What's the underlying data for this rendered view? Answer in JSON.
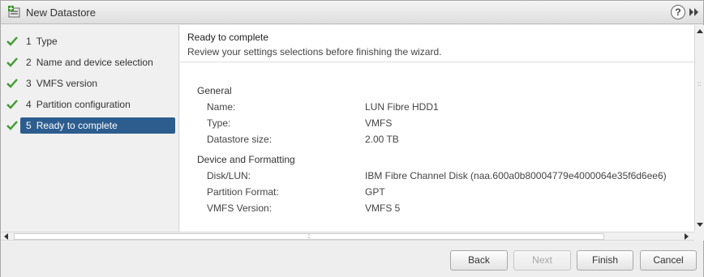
{
  "window": {
    "title": "New Datastore"
  },
  "titlebar_icons": {
    "app": "datastore-add-icon",
    "help": "help-icon",
    "help_glyph": "?",
    "expand": "expand-icon"
  },
  "steps": [
    {
      "number": "1",
      "label": "Type",
      "completed": true,
      "active": false
    },
    {
      "number": "2",
      "label": "Name and device selection",
      "completed": true,
      "active": false
    },
    {
      "number": "3",
      "label": "VMFS version",
      "completed": true,
      "active": false
    },
    {
      "number": "4",
      "label": "Partition configuration",
      "completed": true,
      "active": false
    },
    {
      "number": "5",
      "label": "Ready to complete",
      "completed": true,
      "active": true
    }
  ],
  "content": {
    "header_title": "Ready to complete",
    "header_subtitle": "Review your settings selections before finishing the wizard.",
    "sections": [
      {
        "title": "General",
        "rows": [
          {
            "label": "Name:",
            "value": "LUN Fibre HDD1"
          },
          {
            "label": "Type:",
            "value": "VMFS"
          },
          {
            "label": "Datastore size:",
            "value": "2.00 TB"
          }
        ]
      },
      {
        "title": "Device and Formatting",
        "rows": [
          {
            "label": "Disk/LUN:",
            "value": "IBM Fibre Channel Disk (naa.600a0b80004779e4000064e35f6d6ee6)"
          },
          {
            "label": "Partition Format:",
            "value": "GPT"
          },
          {
            "label": "VMFS Version:",
            "value": "VMFS 5"
          }
        ]
      }
    ]
  },
  "buttons": {
    "back": "Back",
    "next": "Next",
    "finish": "Finish",
    "cancel": "Cancel"
  },
  "colors": {
    "active_step_bg": "#2c5d8e",
    "check_green": "#3e9a2e"
  }
}
